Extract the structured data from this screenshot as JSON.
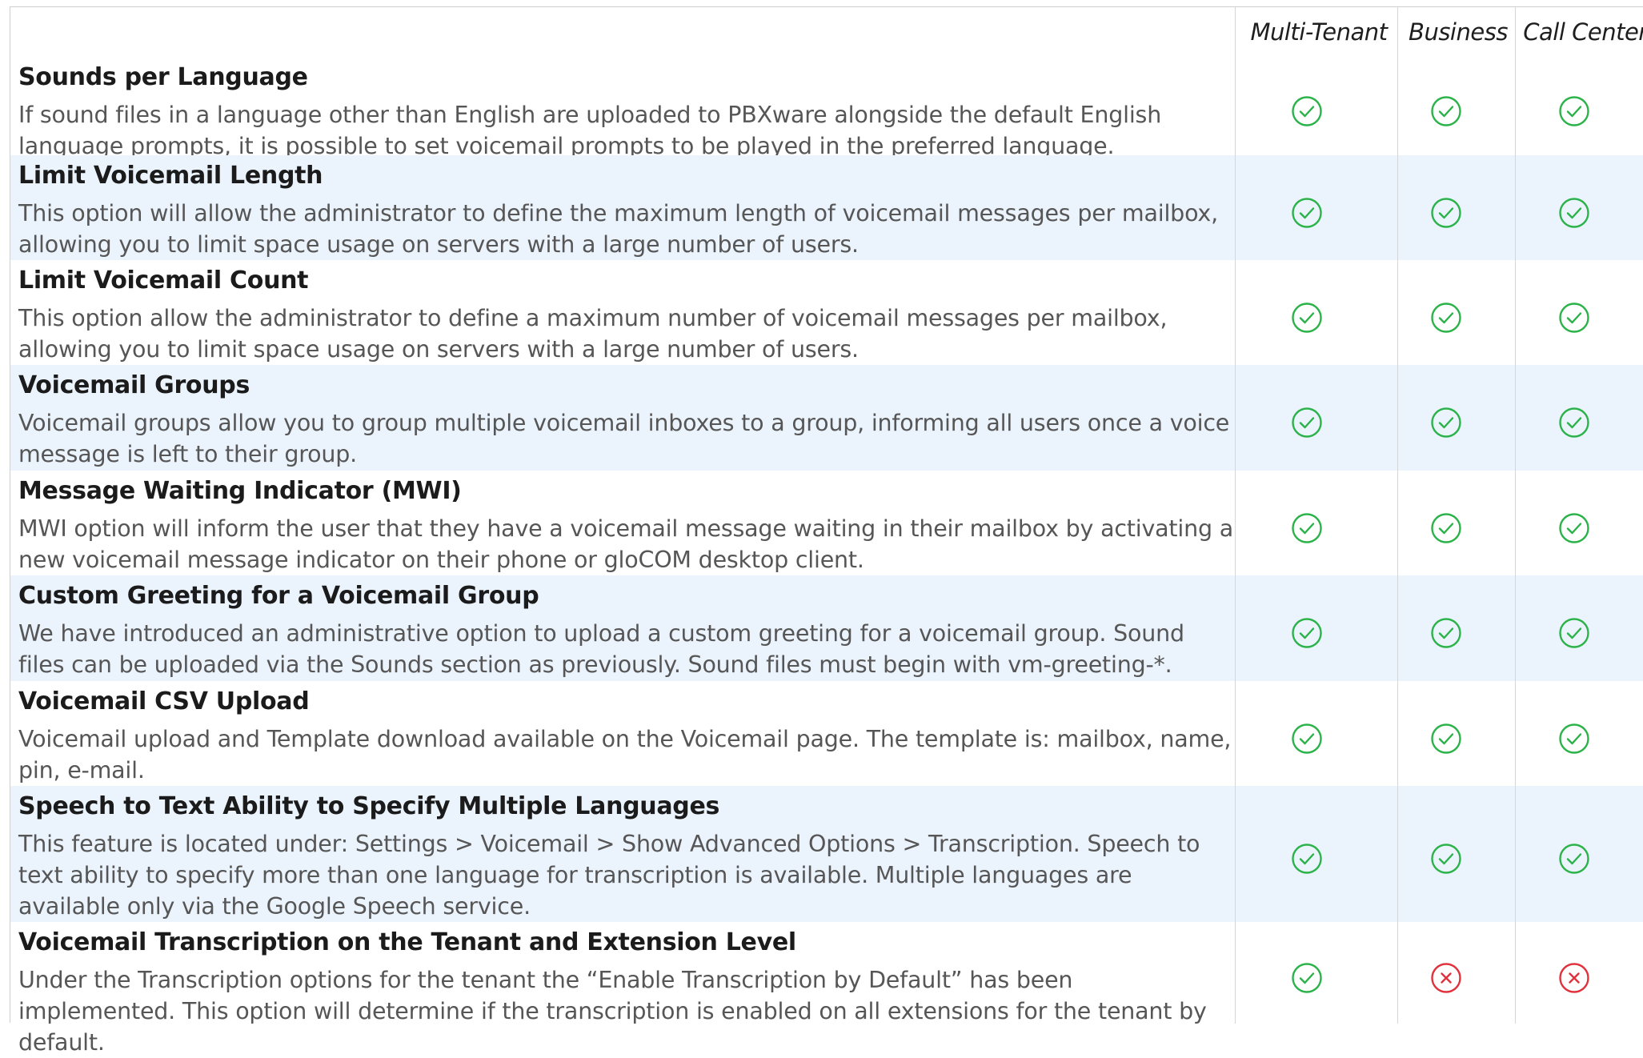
{
  "columns": [
    "Multi-Tenant",
    "Business",
    "Call Center"
  ],
  "colors": {
    "check": "#2bb34a",
    "cross": "#e0313c",
    "shade": "#ebf3fd"
  },
  "rows": [
    {
      "title": "Sounds per Language",
      "description": "If sound files in a language other than English are uploaded to PBXware alongside the default English language prompts, it is possible to set voicemail prompts to be played in the preferred language.",
      "support": [
        "check",
        "check",
        "check"
      ]
    },
    {
      "title": "Limit Voicemail Length",
      "description": "This option will allow the administrator to define the maximum length of voicemail messages per mailbox, allowing you to limit space usage on servers with a large number of users.",
      "support": [
        "check",
        "check",
        "check"
      ]
    },
    {
      "title": "Limit Voicemail Count",
      "description": "This option allow the administrator to define a maximum number of voicemail messages per mailbox, allowing you to limit space usage on servers with a large number of users.",
      "support": [
        "check",
        "check",
        "check"
      ]
    },
    {
      "title": "Voicemail Groups",
      "description": "Voicemail groups allow you to group multiple voicemail inboxes to a group, informing all users once a voice message is left to their group.",
      "support": [
        "check",
        "check",
        "check"
      ]
    },
    {
      "title": "Message Waiting Indicator (MWI)",
      "description": "MWI option will inform the user that they have a voicemail message waiting in their mailbox by activating a new voicemail message indicator on their phone or gloCOM desktop client.",
      "support": [
        "check",
        "check",
        "check"
      ]
    },
    {
      "title": "Custom Greeting for a Voicemail Group",
      "description": "We have introduced an administrative option to upload a custom greeting for a voicemail group. Sound files can be uploaded via the Sounds section as previously. Sound files must begin with vm-greeting-*.",
      "support": [
        "check",
        "check",
        "check"
      ]
    },
    {
      "title": "Voicemail CSV Upload",
      "description": "Voicemail upload and Template download available on the Voicemail page. The template is: mailbox, name, pin, e-mail.",
      "support": [
        "check",
        "check",
        "check"
      ]
    },
    {
      "title": "Speech to Text Ability to Specify Multiple Languages",
      "description": "This feature is located under: Settings > Voicemail > Show Advanced Options > Transcription. Speech to text ability to specify more than one language for transcription is available. Multiple languages are available only via the Google Speech service.",
      "support": [
        "check",
        "check",
        "check"
      ]
    },
    {
      "title": "Voicemail Transcription on the Tenant and Extension Level",
      "description": "Under the Transcription options for the tenant the “Enable Transcription by Default” has been implemented. This option will determine if the transcription is enabled on all extensions for the tenant by default.",
      "support": [
        "check",
        "cross",
        "cross"
      ]
    }
  ]
}
